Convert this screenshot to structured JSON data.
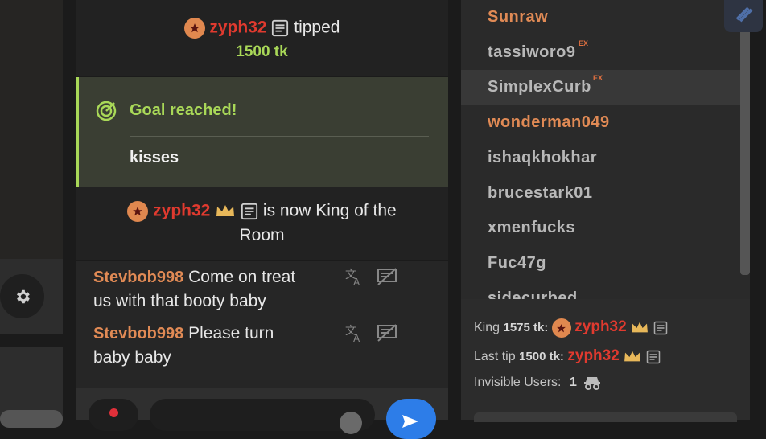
{
  "chat": {
    "tip": {
      "user": "zyph32",
      "verb": "tipped",
      "amount": "1500 tk"
    },
    "goal": {
      "title": "Goal reached!",
      "item": "kisses"
    },
    "king_notice": {
      "user": "zyph32",
      "text_1": "is now King of the",
      "text_2": "Room"
    },
    "messages": [
      {
        "user": "Stevbob998",
        "first": "Come on treat",
        "rest": "us with that booty baby"
      },
      {
        "user": "Stevbob998",
        "first": "Please turn",
        "rest": "baby baby"
      }
    ]
  },
  "users": [
    {
      "name": "Sunraw",
      "color": "#e08a55",
      "ex": ""
    },
    {
      "name": "tassiworo9",
      "color": "#b8b8b8",
      "ex": "EX"
    },
    {
      "name": "SimplexCurb",
      "color": "#b8b8b8",
      "ex": "EX"
    },
    {
      "name": "wonderman049",
      "color": "#e08a55",
      "ex": ""
    },
    {
      "name": "ishaqkhokhar",
      "color": "#b8b8b8",
      "ex": ""
    },
    {
      "name": "brucestark01",
      "color": "#b8b8b8",
      "ex": ""
    },
    {
      "name": "xmenfucks",
      "color": "#b8b8b8",
      "ex": ""
    },
    {
      "name": "Fuc47g",
      "color": "#b8b8b8",
      "ex": ""
    },
    {
      "name": "sidecurbed",
      "color": "#b8b8b8",
      "ex": ""
    }
  ],
  "info": {
    "king_label": "King",
    "king_amount": "1575 tk:",
    "king_user": "zyph32",
    "last_tip_label": "Last tip",
    "last_tip_amount": "1500 tk:",
    "last_tip_user": "zyph32",
    "invisible_label": "Invisible Users:",
    "invisible_count": "1"
  },
  "colors": {
    "accent_green": "#a9d858",
    "user_red": "#e03a2f",
    "user_orange": "#e08a55"
  }
}
